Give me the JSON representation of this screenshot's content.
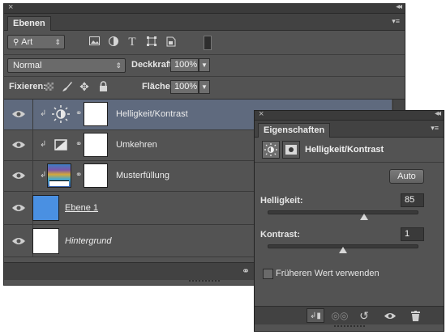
{
  "layers_panel": {
    "tab": "Ebenen",
    "filter_type": "Art",
    "blend_mode": "Normal",
    "opacity_label": "Deckkraft:",
    "opacity_value": "100%",
    "lock_label": "Fixieren:",
    "fill_label": "Fläche:",
    "fill_value": "100%",
    "layers": [
      {
        "name": "Helligkeit/Kontrast",
        "selected": true,
        "type": "brightness-contrast"
      },
      {
        "name": "Umkehren",
        "selected": false,
        "type": "invert"
      },
      {
        "name": "Musterfüllung",
        "selected": false,
        "type": "pattern"
      },
      {
        "name": "Ebene 1",
        "selected": false,
        "type": "pixel",
        "color": "#4a90e2"
      },
      {
        "name": "Hintergrund",
        "selected": false,
        "type": "background"
      }
    ]
  },
  "properties_panel": {
    "tab": "Eigenschaften",
    "title": "Helligkeit/Kontrast",
    "auto_button": "Auto",
    "brightness_label": "Helligkeit:",
    "brightness_value": "85",
    "brightness_level": 0.64,
    "contrast_label": "Kontrast:",
    "contrast_value": "1",
    "contrast_level": 0.5,
    "legacy_label": "Früheren Wert verwenden",
    "legacy_checked": false
  },
  "icons": {
    "close": "×",
    "collapse": "◂◂",
    "panel_menu": "▾≡"
  }
}
